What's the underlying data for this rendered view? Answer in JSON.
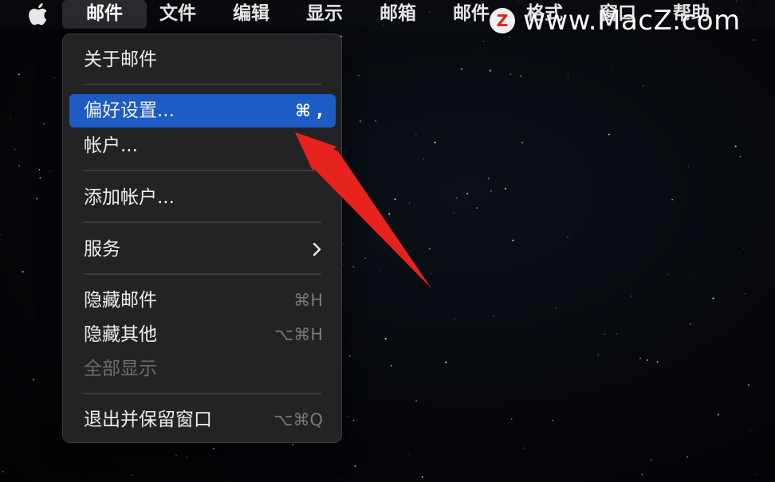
{
  "menubar": {
    "items": [
      {
        "label": "邮件",
        "active": true
      },
      {
        "label": "文件"
      },
      {
        "label": "编辑"
      },
      {
        "label": "显示"
      },
      {
        "label": "邮箱"
      },
      {
        "label": "邮件"
      },
      {
        "label": "格式"
      },
      {
        "label": "窗口"
      },
      {
        "label": "帮助"
      }
    ]
  },
  "watermark": {
    "logo_letter": "Z",
    "text": "www.MacZ.com"
  },
  "menu": {
    "items": [
      {
        "label": "关于邮件",
        "shortcut": ""
      },
      {
        "label": "偏好设置...",
        "shortcut": "⌘ ,",
        "selected": true
      },
      {
        "label": "帐户...",
        "shortcut": ""
      },
      {
        "label": "添加帐户...",
        "shortcut": ""
      },
      {
        "label": "服务",
        "submenu": true
      },
      {
        "label": "隐藏邮件",
        "shortcut": "⌘H"
      },
      {
        "label": "隐藏其他",
        "shortcut": "⌥⌘H"
      },
      {
        "label": "全部显示",
        "shortcut": "",
        "disabled": true
      },
      {
        "label": "退出并保留窗口",
        "shortcut": "⌥⌘Q"
      }
    ]
  },
  "colors": {
    "selection": "#1d5cc4",
    "annotation_arrow": "#e8231d",
    "menu_bg": "#232325"
  }
}
